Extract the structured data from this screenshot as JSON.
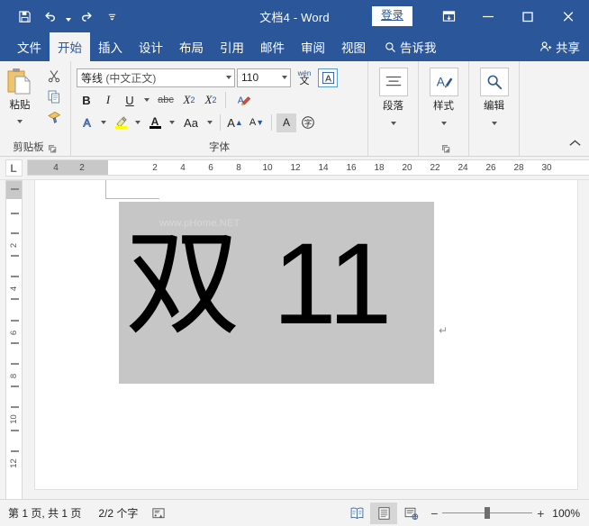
{
  "titlebar": {
    "document_title": "文档4  -  Word",
    "quick_access": [
      {
        "name": "save",
        "icon": "save-icon"
      },
      {
        "name": "undo",
        "icon": "undo-icon"
      },
      {
        "name": "redo",
        "icon": "redo-icon"
      },
      {
        "name": "customize",
        "icon": "customize-qat-icon"
      }
    ],
    "signin_label": "登录",
    "ribbon_display_options": "ribbon-display-options-icon",
    "minimize": "minimize-icon",
    "maximize": "maximize-icon",
    "close": "close-icon",
    "brand_color": "#2b579a"
  },
  "tabs": [
    {
      "label": "文件",
      "active": false
    },
    {
      "label": "开始",
      "active": true
    },
    {
      "label": "插入",
      "active": false
    },
    {
      "label": "设计",
      "active": false
    },
    {
      "label": "布局",
      "active": false
    },
    {
      "label": "引用",
      "active": false
    },
    {
      "label": "邮件",
      "active": false
    },
    {
      "label": "审阅",
      "active": false
    },
    {
      "label": "视图",
      "active": false
    }
  ],
  "tellme_label": "告诉我",
  "share_label": "共享",
  "ribbon": {
    "clipboard": {
      "group_label": "剪贴板",
      "paste_label": "粘贴",
      "cut_icon": "scissors-icon",
      "copy_icon": "copy-icon",
      "format_painter_icon": "format-painter-icon"
    },
    "font": {
      "group_label": "字体",
      "font_name": "等线",
      "font_name_suffix": " (中文正文)",
      "font_size": "110",
      "bold": "B",
      "italic": "I",
      "underline": "U",
      "strikethrough": "abc",
      "subscript": "X",
      "subscript_index": "2",
      "superscript": "X",
      "superscript_index": "2",
      "clear_formatting_icon": "clear-formatting-icon",
      "text_effects_icon": "text-effects-icon",
      "highlight_icon": "highlight-color-icon",
      "font_color_icon": "font-color-icon",
      "change_case": "Aa",
      "grow_font": "A",
      "shrink_font": "A",
      "char_border_icon": "character-border-icon",
      "phonetic_guide_top": "wén",
      "phonetic_guide_bottom": "文",
      "enclose_char_icon": "enclose-character-icon",
      "shading_icon": "character-shading-icon"
    },
    "paragraph": {
      "label": "段落",
      "icon": "paragraph-icon"
    },
    "styles": {
      "label": "样式",
      "icon": "styles-icon"
    },
    "editing": {
      "label": "编辑",
      "icon": "editing-find-icon"
    },
    "collapse_icon": "collapse-ribbon-icon"
  },
  "ruler": {
    "tab_stop_marker": "L",
    "horizontal_ticks": [
      "4",
      "2",
      "2",
      "4",
      "6",
      "8",
      "10",
      "12",
      "14",
      "16",
      "18",
      "20",
      "22",
      "24",
      "26",
      "28",
      "30"
    ],
    "vertical_ticks": [
      "2",
      "4",
      "6",
      "8",
      "10",
      "12"
    ]
  },
  "document": {
    "selected_text": "双 11",
    "watermark": "www.pHome.NET",
    "paragraph_mark": "↵"
  },
  "statusbar": {
    "page_info": "第 1 页, 共 1 页",
    "word_count": "2/2 个字",
    "proofing_icon": "proofing-status-icon",
    "views": [
      {
        "name": "read-mode",
        "icon": "read-mode-icon",
        "active": false
      },
      {
        "name": "print-layout",
        "icon": "print-layout-icon",
        "active": true
      },
      {
        "name": "web-layout",
        "icon": "web-layout-icon",
        "active": false
      }
    ],
    "zoom_out": "−",
    "zoom_in": "+",
    "zoom_value": "100%"
  }
}
